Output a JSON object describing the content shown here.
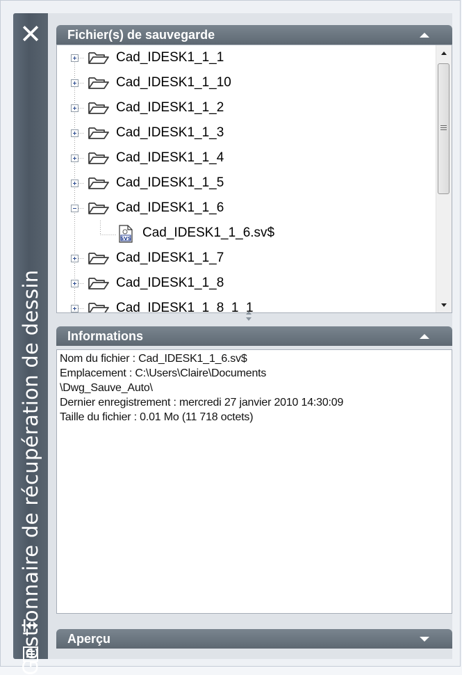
{
  "window": {
    "title": "Gestionnaire de récupération de dessin",
    "close_label": "✕"
  },
  "backup_panel": {
    "header": "Fichier(s) de sauvegarde",
    "items": [
      {
        "label": "Cad_IDESK1_1_1",
        "expanded": false
      },
      {
        "label": "Cad_IDESK1_1_10",
        "expanded": false
      },
      {
        "label": "Cad_IDESK1_1_2",
        "expanded": false
      },
      {
        "label": "Cad_IDESK1_1_3",
        "expanded": false
      },
      {
        "label": "Cad_IDESK1_1_4",
        "expanded": false
      },
      {
        "label": "Cad_IDESK1_1_5",
        "expanded": false
      },
      {
        "label": "Cad_IDESK1_1_6",
        "expanded": true,
        "child": "Cad_IDESK1_1_6.sv$"
      },
      {
        "label": "Cad_IDESK1_1_7",
        "expanded": false
      },
      {
        "label": "Cad_IDESK1_1_8",
        "expanded": false
      },
      {
        "label": "Cad_IDESK1_1_8_1_1",
        "expanded": false
      }
    ]
  },
  "info_panel": {
    "header": "Informations",
    "lines": [
      "Nom du fichier : Cad_IDESK1_1_6.sv$",
      "Emplacement : C:\\Users\\Claire\\Documents",
      "\\Dwg_Sauve_Auto\\",
      "Dernier enregistrement : mercredi 27 janvier 2010 14:30:09",
      "Taille du fichier : 0.01 Mo (11 718 octets)"
    ]
  },
  "preview_panel": {
    "header": "Aperçu"
  },
  "colors": {
    "title_bar": "#4d5864",
    "panel_header": "#6a747e",
    "background": "#dfe3e8",
    "folder_stroke": "#3d3d3d"
  },
  "icons": [
    "close-icon",
    "expand-icon",
    "collapse-icon",
    "folder-icon",
    "sv-file-icon",
    "chevron-up-icon",
    "chevron-down-icon",
    "scroll-up-icon",
    "scroll-down-icon",
    "properties-icon",
    "menu-icon",
    "splitter-icon"
  ]
}
